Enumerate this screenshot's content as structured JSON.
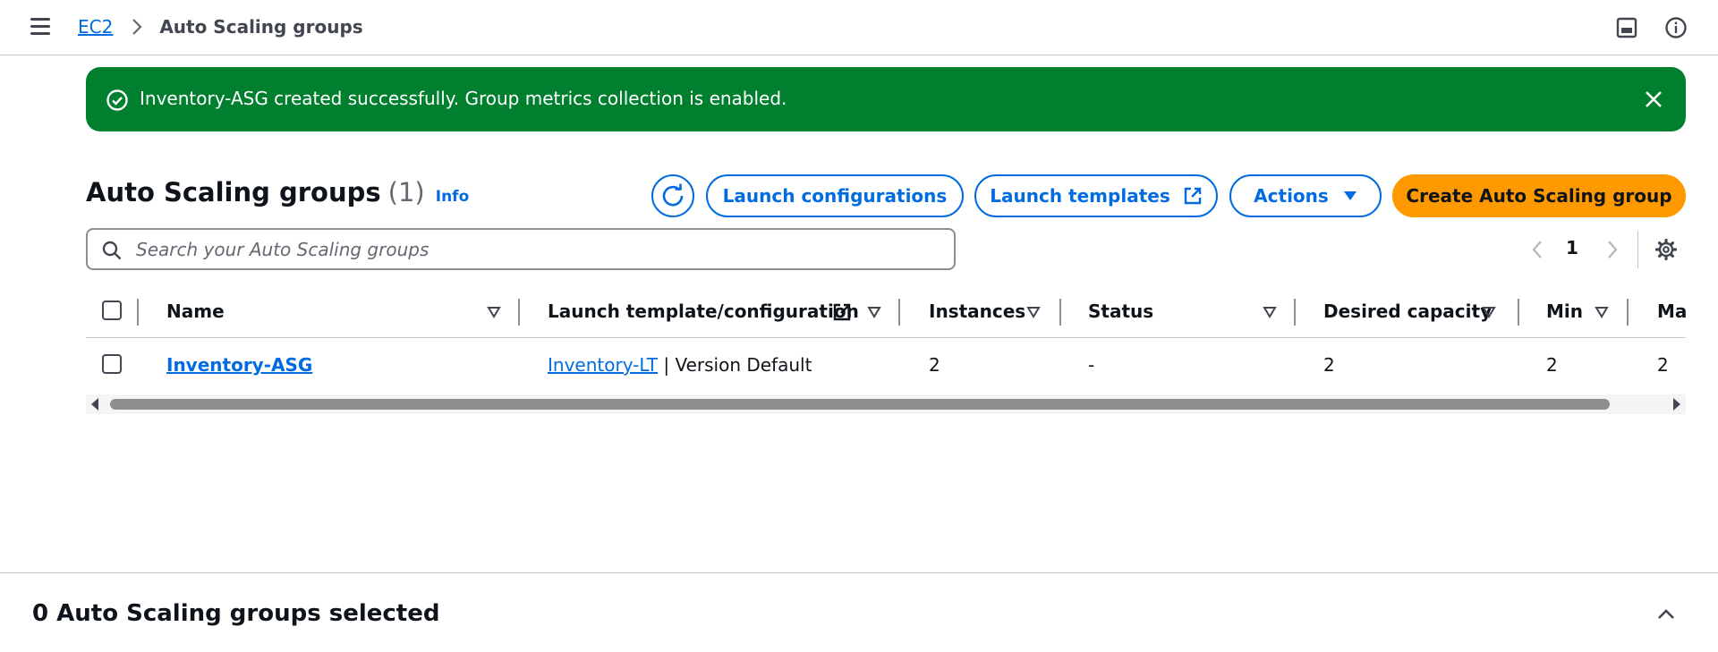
{
  "breadcrumb": {
    "root": "EC2",
    "current": "Auto Scaling groups"
  },
  "flash": {
    "message": "Inventory-ASG created successfully. Group metrics collection is enabled."
  },
  "heading": {
    "title": "Auto Scaling groups",
    "count": "(1)",
    "info": "Info"
  },
  "toolbar": {
    "launch_configurations": "Launch configurations",
    "launch_templates": "Launch templates",
    "actions": "Actions",
    "create": "Create Auto Scaling group"
  },
  "search": {
    "placeholder": "Search your Auto Scaling groups",
    "value": ""
  },
  "pagination": {
    "current_page": "1"
  },
  "table": {
    "columns": [
      "Name",
      "Launch template/configuration",
      "Instances",
      "Status",
      "Desired capacity",
      "Min",
      "Max"
    ],
    "rows": [
      {
        "name": "Inventory-ASG",
        "launch_template_link": "Inventory-LT",
        "launch_template_suffix": " | Version Default",
        "instances": "2",
        "status": "-",
        "desired_capacity": "2",
        "min": "2",
        "max": "2"
      }
    ]
  },
  "bottom_panel": {
    "title": "0 Auto Scaling groups selected"
  },
  "colors": {
    "primary": "#006ce0",
    "success": "#00802f",
    "create_button": "#ff9900"
  }
}
